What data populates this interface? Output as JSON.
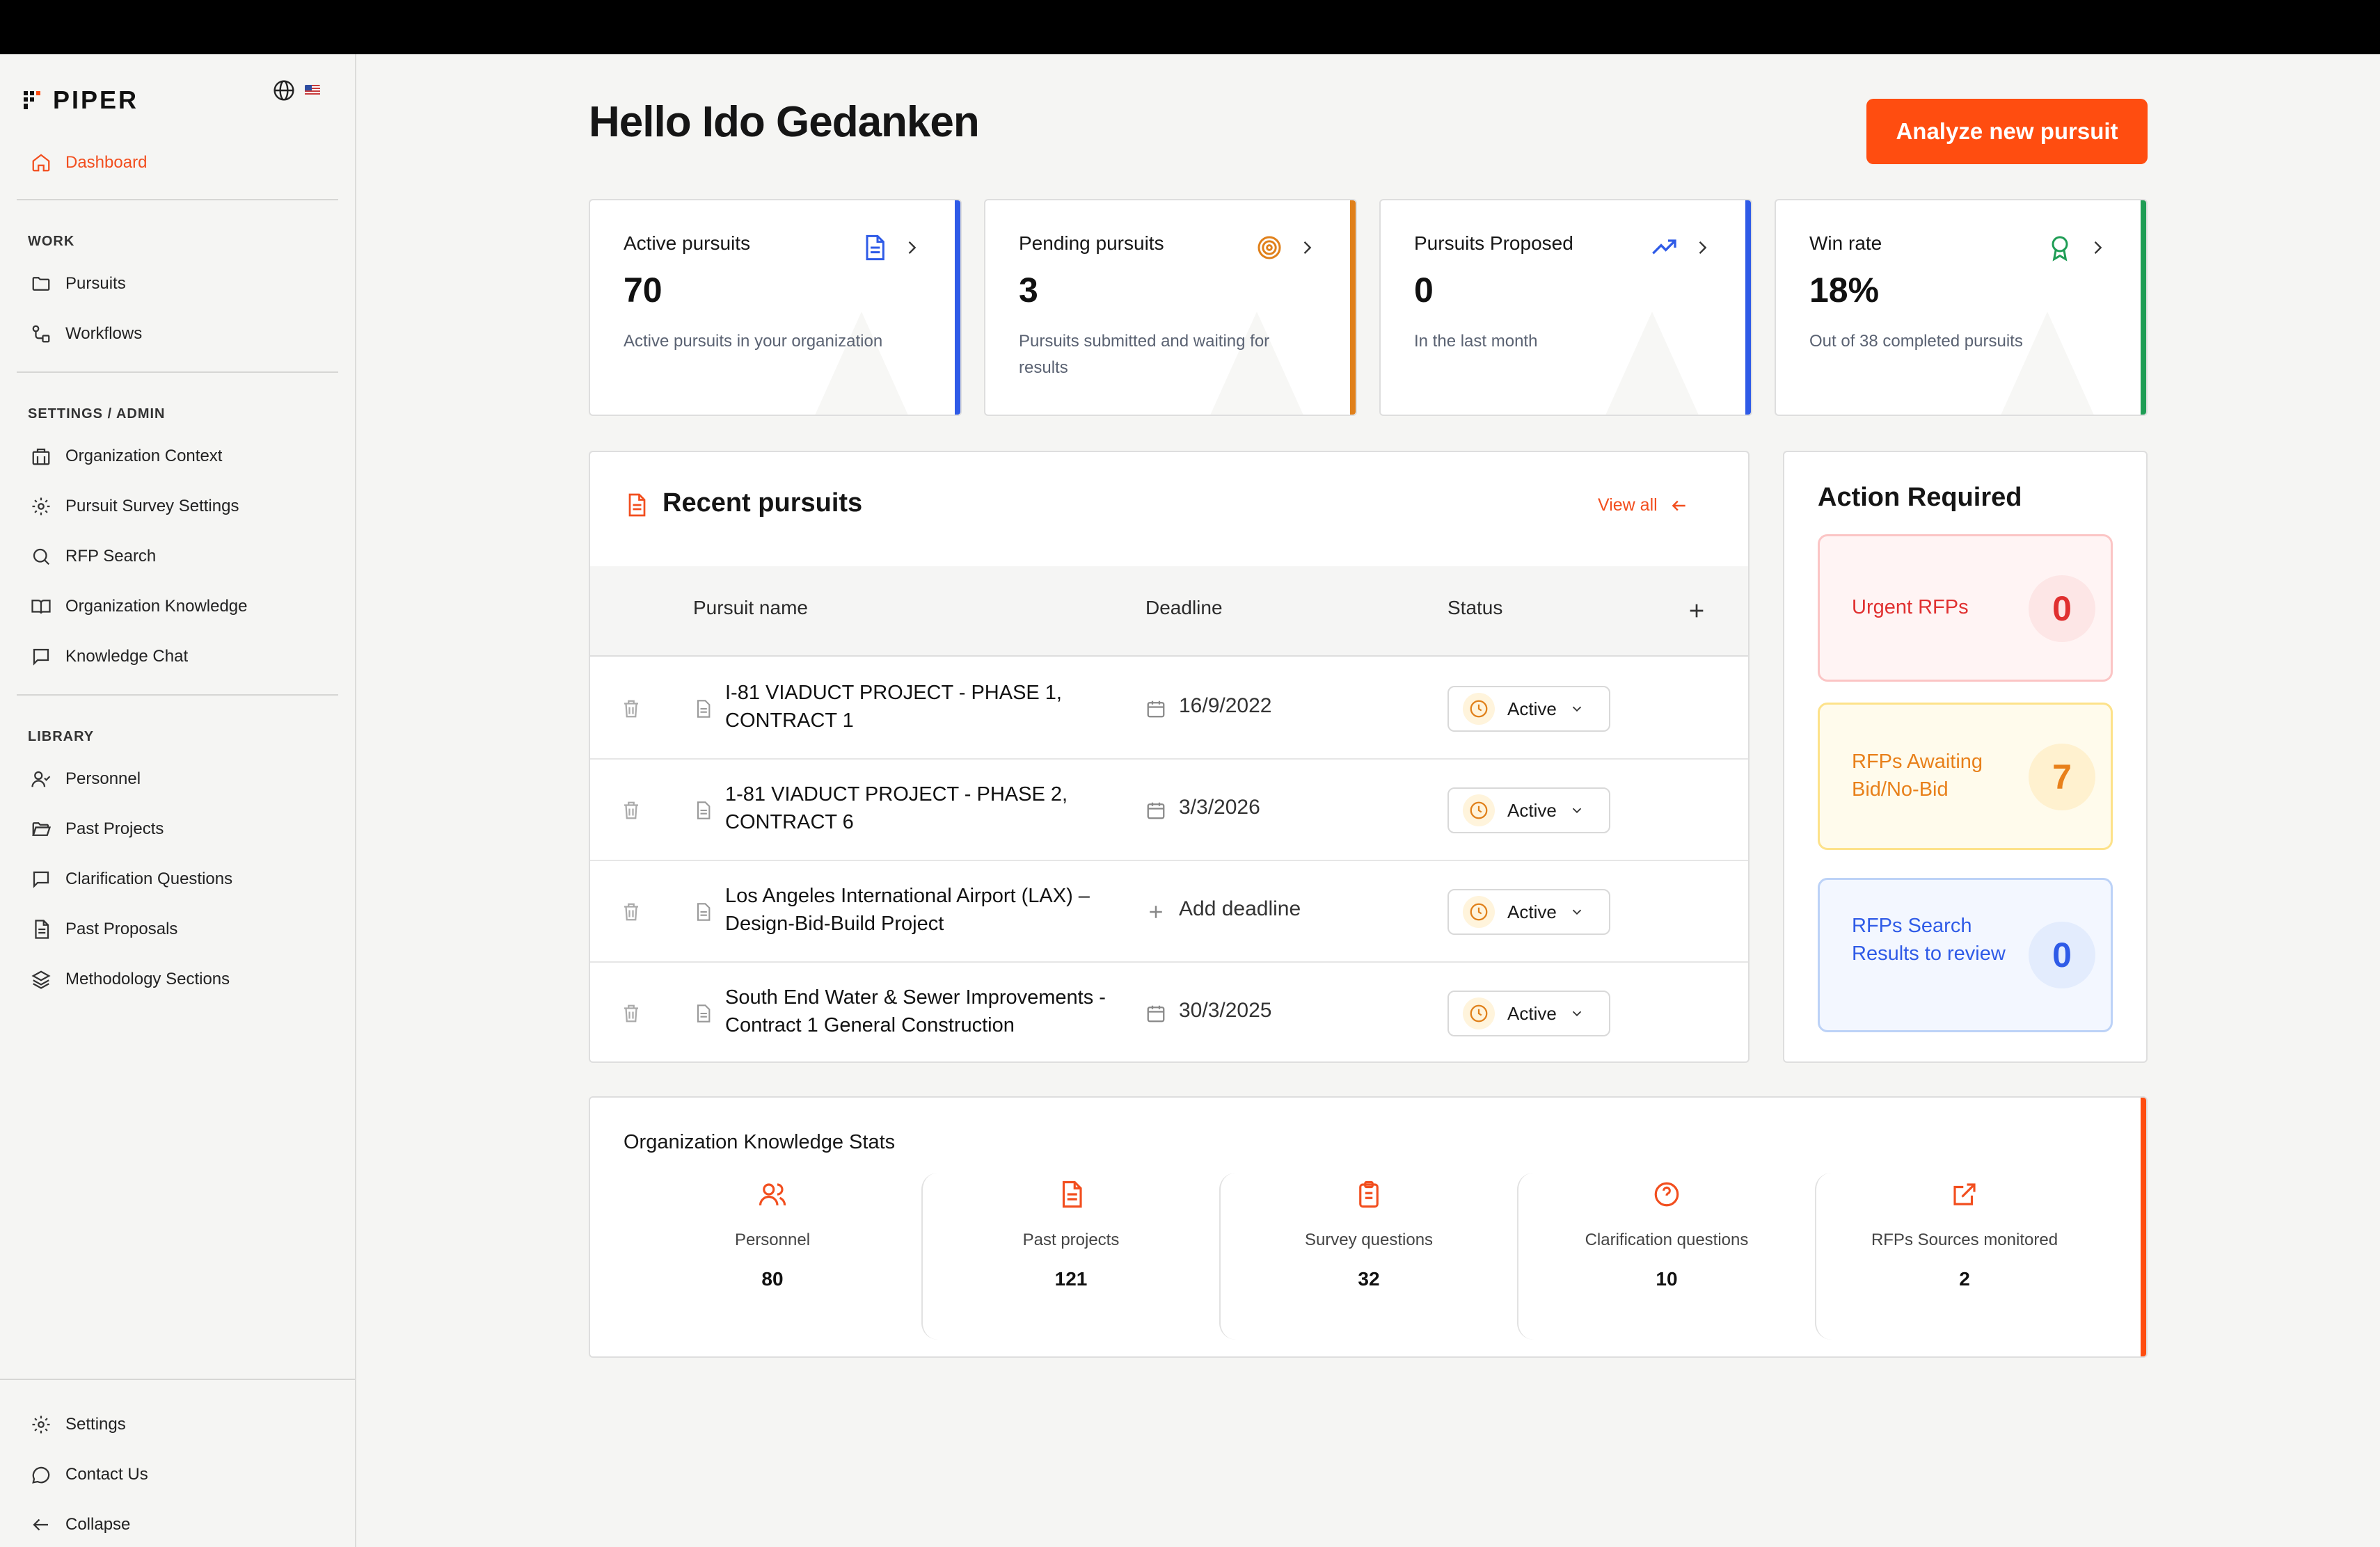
{
  "brand": {
    "name": "PIPER"
  },
  "sidebar": {
    "dashboard": "Dashboard",
    "work_label": "WORK",
    "work": [
      "Pursuits",
      "Workflows"
    ],
    "settings_label": "SETTINGS / ADMIN",
    "settings": [
      "Organization Context",
      "Pursuit Survey Settings",
      "RFP Search",
      "Organization Knowledge",
      "Knowledge Chat"
    ],
    "library_label": "LIBRARY",
    "library": [
      "Personnel",
      "Past Projects",
      "Clarification Questions",
      "Past Proposals",
      "Methodology Sections"
    ],
    "footer": [
      "Settings",
      "Contact Us",
      "Collapse"
    ]
  },
  "header": {
    "greeting": "Hello Ido Gedanken",
    "cta": "Analyze new pursuit"
  },
  "stats": [
    {
      "title": "Active pursuits",
      "value": "70",
      "desc": "Active pursuits in your organization",
      "color": "#2f5be7",
      "icon": "document-icon"
    },
    {
      "title": "Pending pursuits",
      "value": "3",
      "desc": "Pursuits submitted and waiting for results",
      "color": "#e0801a",
      "icon": "target-icon"
    },
    {
      "title": "Pursuits Proposed",
      "value": "0",
      "desc": "In the last month",
      "color": "#2f5be7",
      "icon": "trend-up-icon"
    },
    {
      "title": "Win rate",
      "value": "18%",
      "desc": "Out of 38 completed pursuits",
      "color": "#1f9d55",
      "icon": "award-icon"
    }
  ],
  "recent": {
    "title": "Recent pursuits",
    "view_all": "View all",
    "headers": {
      "name": "Pursuit name",
      "deadline": "Deadline",
      "status": "Status"
    },
    "rows": [
      {
        "name": "I-81 VIADUCT PROJECT - PHASE 1, CONTRACT 1",
        "deadline": "16/9/2022",
        "status": "Active"
      },
      {
        "name": "1-81 VIADUCT PROJECT - PHASE 2, CONTRACT 6",
        "deadline": "3/3/2026",
        "status": "Active"
      },
      {
        "name": "Los Angeles International Airport (LAX) – Design-Bid-Build Project",
        "deadline": "Add deadline",
        "status": "Active"
      },
      {
        "name": "South End Water & Sewer Improvements - Contract 1 General Construction",
        "deadline": "30/3/2025",
        "status": "Active"
      }
    ]
  },
  "action": {
    "title": "Action Required",
    "items": [
      {
        "label": "Urgent RFPs",
        "value": "0",
        "color": "#e03030"
      },
      {
        "label": "RFPs Awaiting Bid/No-Bid",
        "value": "7",
        "color": "#e8801a"
      },
      {
        "label": "RFPs Search Results to review",
        "value": "0",
        "color": "#2f5be7"
      }
    ]
  },
  "knowledge": {
    "title": "Organization Knowledge Stats",
    "items": [
      {
        "label": "Personnel",
        "value": "80",
        "icon": "users-icon"
      },
      {
        "label": "Past projects",
        "value": "121",
        "icon": "file-text-icon"
      },
      {
        "label": "Survey questions",
        "value": "32",
        "icon": "clipboard-icon"
      },
      {
        "label": "Clarification questions",
        "value": "10",
        "icon": "help-circle-icon"
      },
      {
        "label": "RFPs Sources monitored",
        "value": "2",
        "icon": "external-link-icon"
      }
    ]
  }
}
